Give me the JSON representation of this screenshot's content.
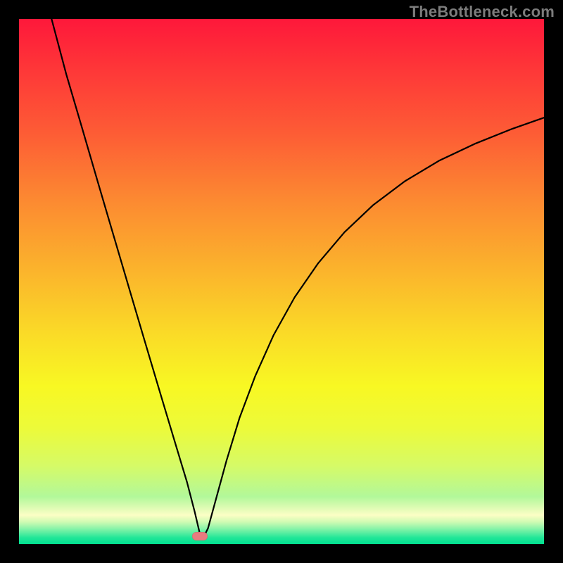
{
  "watermark": {
    "text": "TheBottleneck.com"
  },
  "marker": {
    "x_frac": 0.345,
    "y_frac": 0.985,
    "color": "#e77b7f"
  },
  "gradient": {
    "stops": [
      {
        "offset": 0.0,
        "color": "#fe183a"
      },
      {
        "offset": 0.1,
        "color": "#fe3838"
      },
      {
        "offset": 0.22,
        "color": "#fd5d35"
      },
      {
        "offset": 0.35,
        "color": "#fc8b31"
      },
      {
        "offset": 0.48,
        "color": "#fbb42c"
      },
      {
        "offset": 0.6,
        "color": "#fadb27"
      },
      {
        "offset": 0.7,
        "color": "#f8f823"
      },
      {
        "offset": 0.78,
        "color": "#ecfa3a"
      },
      {
        "offset": 0.85,
        "color": "#d6fa66"
      },
      {
        "offset": 0.91,
        "color": "#b2f89a"
      },
      {
        "offset": 0.945,
        "color": "#fcfec5"
      },
      {
        "offset": 0.958,
        "color": "#d0fbb3"
      },
      {
        "offset": 0.968,
        "color": "#98f5ab"
      },
      {
        "offset": 0.978,
        "color": "#5eeea2"
      },
      {
        "offset": 0.988,
        "color": "#22e698"
      },
      {
        "offset": 1.0,
        "color": "#00e090"
      }
    ]
  },
  "chart_data": {
    "type": "line",
    "title": "",
    "xlabel": "",
    "ylabel": "",
    "xlim": [
      0,
      1
    ],
    "ylim": [
      0,
      1
    ],
    "watermark": "TheBottleneck.com",
    "series": [
      {
        "name": "left-branch",
        "points": [
          {
            "x": 0.062,
            "y": 1.0
          },
          {
            "x": 0.09,
            "y": 0.895
          },
          {
            "x": 0.12,
            "y": 0.793
          },
          {
            "x": 0.15,
            "y": 0.69
          },
          {
            "x": 0.18,
            "y": 0.588
          },
          {
            "x": 0.21,
            "y": 0.486
          },
          {
            "x": 0.24,
            "y": 0.385
          },
          {
            "x": 0.27,
            "y": 0.284
          },
          {
            "x": 0.3,
            "y": 0.184
          },
          {
            "x": 0.32,
            "y": 0.118
          },
          {
            "x": 0.335,
            "y": 0.06
          },
          {
            "x": 0.345,
            "y": 0.017
          },
          {
            "x": 0.35,
            "y": 0.01
          }
        ]
      },
      {
        "name": "right-branch",
        "points": [
          {
            "x": 0.35,
            "y": 0.01
          },
          {
            "x": 0.36,
            "y": 0.03
          },
          {
            "x": 0.375,
            "y": 0.085
          },
          {
            "x": 0.395,
            "y": 0.158
          },
          {
            "x": 0.42,
            "y": 0.24
          },
          {
            "x": 0.45,
            "y": 0.32
          },
          {
            "x": 0.485,
            "y": 0.398
          },
          {
            "x": 0.525,
            "y": 0.47
          },
          {
            "x": 0.57,
            "y": 0.535
          },
          {
            "x": 0.62,
            "y": 0.594
          },
          {
            "x": 0.675,
            "y": 0.646
          },
          {
            "x": 0.735,
            "y": 0.691
          },
          {
            "x": 0.8,
            "y": 0.73
          },
          {
            "x": 0.87,
            "y": 0.763
          },
          {
            "x": 0.94,
            "y": 0.791
          },
          {
            "x": 1.0,
            "y": 0.812
          }
        ]
      }
    ],
    "marker": {
      "x": 0.345,
      "y": 0.015,
      "color": "#e77b7f"
    }
  }
}
